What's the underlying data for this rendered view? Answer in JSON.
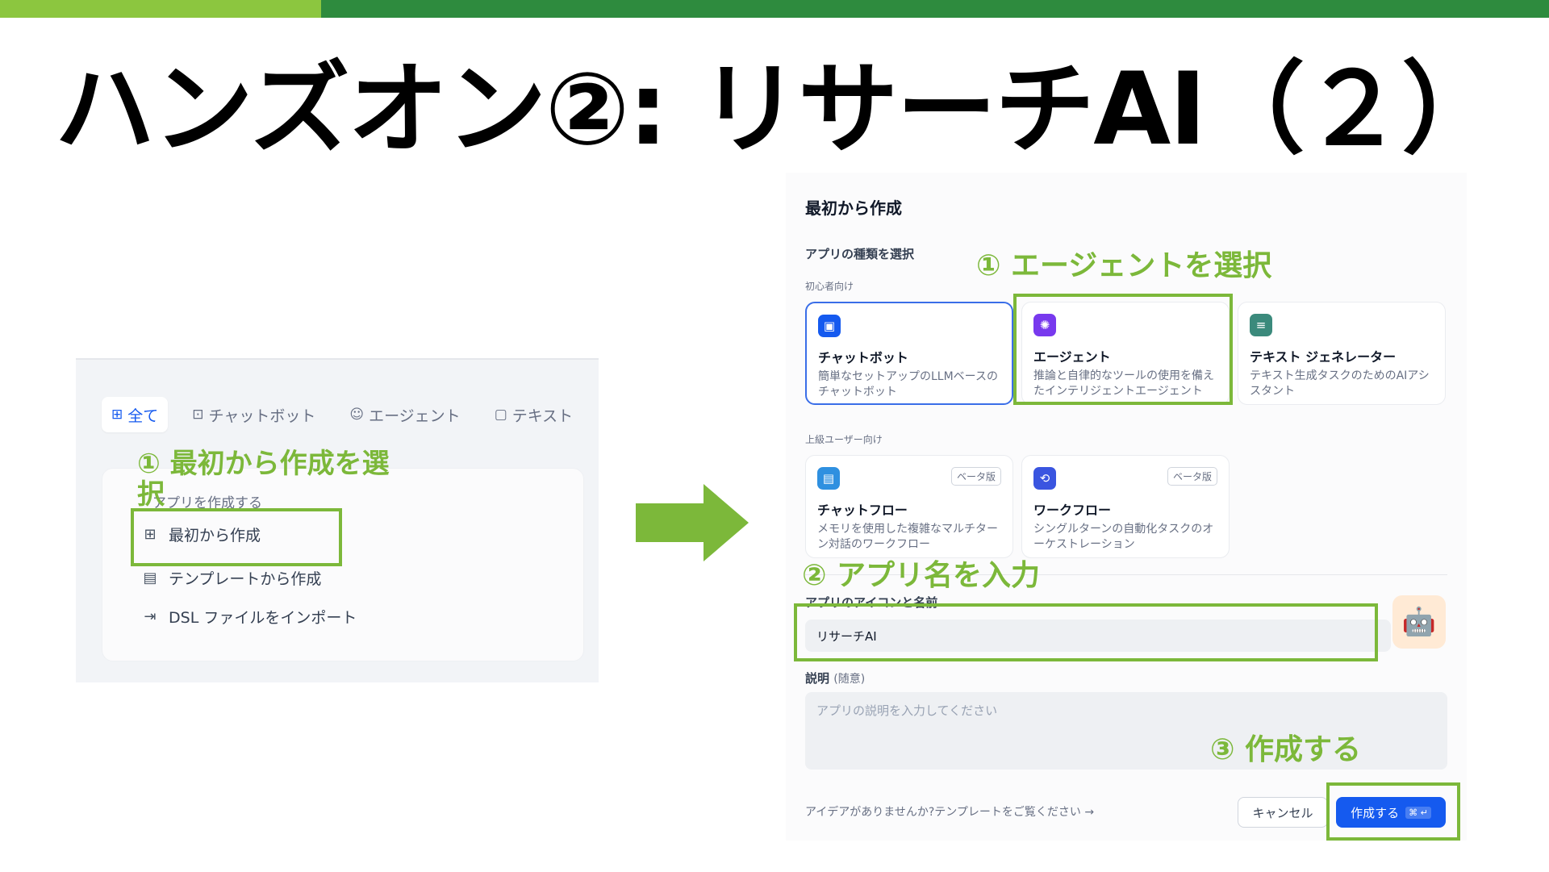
{
  "slide": {
    "title": "ハンズオン②: リサーチAI（２）"
  },
  "left_panel": {
    "tabs": [
      {
        "icon": "grid-icon",
        "glyph": "⊞",
        "label": "全て"
      },
      {
        "icon": "chatbot-icon",
        "glyph": "⊡",
        "label": "チャットボット"
      },
      {
        "icon": "agent-icon",
        "glyph": "☺",
        "label": "エージェント"
      },
      {
        "icon": "text-icon",
        "glyph": "▢",
        "label": "テキスト"
      }
    ],
    "menu_heading": "アプリを作成する",
    "menu_items": [
      {
        "icon": "file-plus-icon",
        "glyph": "⊞",
        "label": "最初から作成"
      },
      {
        "icon": "template-icon",
        "glyph": "▤",
        "label": "テンプレートから作成"
      },
      {
        "icon": "import-icon",
        "glyph": "⇥",
        "label": "DSL ファイルをインポート"
      }
    ]
  },
  "dialog": {
    "title": "最初から作成",
    "section_title": "アプリの種類を選択",
    "beginner_label": "初心者向け",
    "advanced_label": "上級ユーザー向け",
    "beginner_cards": [
      {
        "name": "チャットボット",
        "desc": "簡単なセットアップのLLMベースのチャットボット",
        "icon": "chatbot-icon",
        "glyph": "▣",
        "color": "#155aef"
      },
      {
        "name": "エージェント",
        "desc": "推論と自律的なツールの使用を備えたインテリジェントエージェント",
        "icon": "agent-icon",
        "glyph": "✺",
        "color": "#7839ee"
      },
      {
        "name": "テキスト ジェネレーター",
        "desc": "テキスト生成タスクのためのAIアシスタント",
        "icon": "text-generator-icon",
        "glyph": "≡",
        "color": "#3b8a7c"
      }
    ],
    "advanced_cards": [
      {
        "name": "チャットフロー",
        "desc": "メモリを使用した複雑なマルチターン対話のワークフロー",
        "icon": "chatflow-icon",
        "glyph": "▤",
        "color": "#2f90e0",
        "badge": "ベータ版"
      },
      {
        "name": "ワークフロー",
        "desc": "シングルターンの自動化タスクのオーケストレーション",
        "icon": "workflow-icon",
        "glyph": "⟲",
        "color": "#3a55e0",
        "badge": "ベータ版"
      }
    ],
    "name_label": "アプリのアイコンと名前",
    "name_value": "リサーチAI",
    "app_icon": "🤖",
    "desc_label": "説明",
    "desc_optional": "(随意)",
    "desc_placeholder": "アプリの説明を入力してください",
    "hint": "アイデアがありませんか?テンプレートをご覧ください →",
    "cancel_label": "キャンセル",
    "create_label": "作成する",
    "create_kbd": "⌘ ↵"
  },
  "annotations": {
    "left_step": "① 最初から作成を選択",
    "agent_step": "① エージェントを選択",
    "name_step": "② アプリ名を入力",
    "create_step": "③ 作成する"
  },
  "colors": {
    "highlight": "#7cb83a",
    "primary": "#155aef",
    "top_bar_dark": "#2e8b3e",
    "top_bar_light": "#8cc63f"
  }
}
